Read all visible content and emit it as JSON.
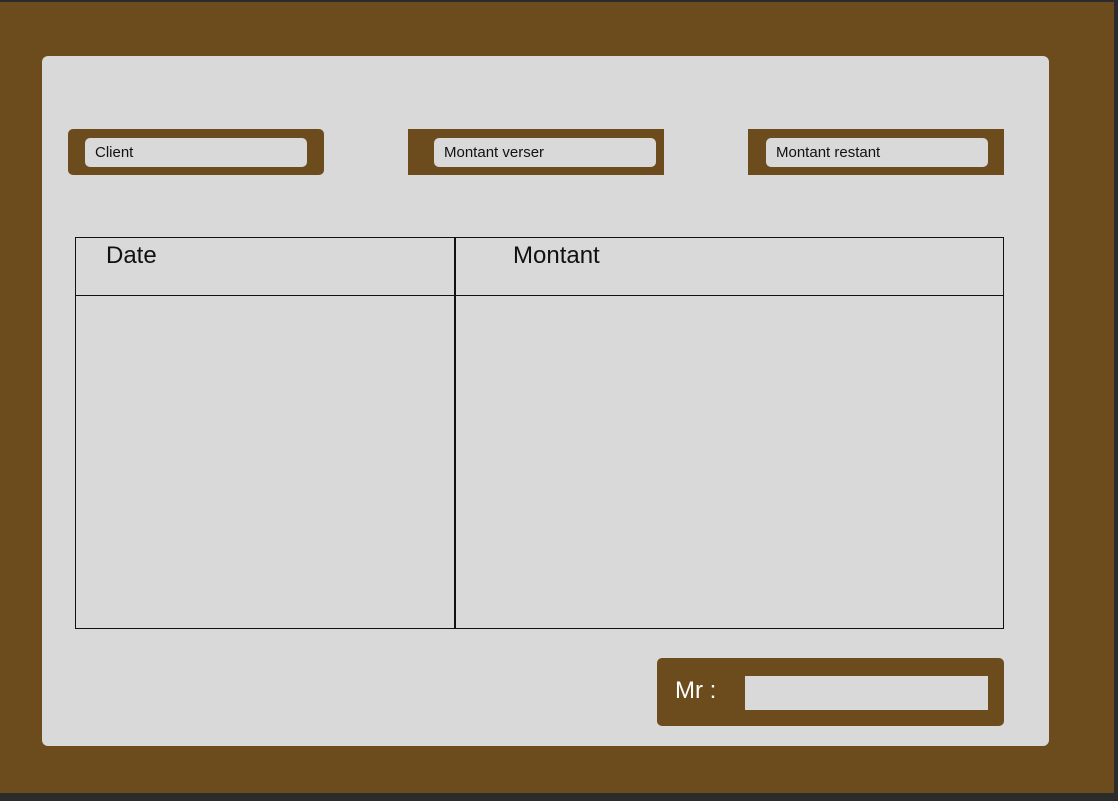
{
  "fields": {
    "client": {
      "label": "Client"
    },
    "montant_verse": {
      "label": "Montant verser"
    },
    "montant_restant": {
      "label": "Montant restant"
    }
  },
  "table": {
    "columns": [
      "Date",
      "Montant"
    ],
    "rows": []
  },
  "footer": {
    "mr_label": "Mr :",
    "mr_value": ""
  },
  "colors": {
    "brand_brown": "#6c4b1d",
    "card_gray": "#d9d9d9",
    "outer_dark": "#2b2b2b"
  }
}
